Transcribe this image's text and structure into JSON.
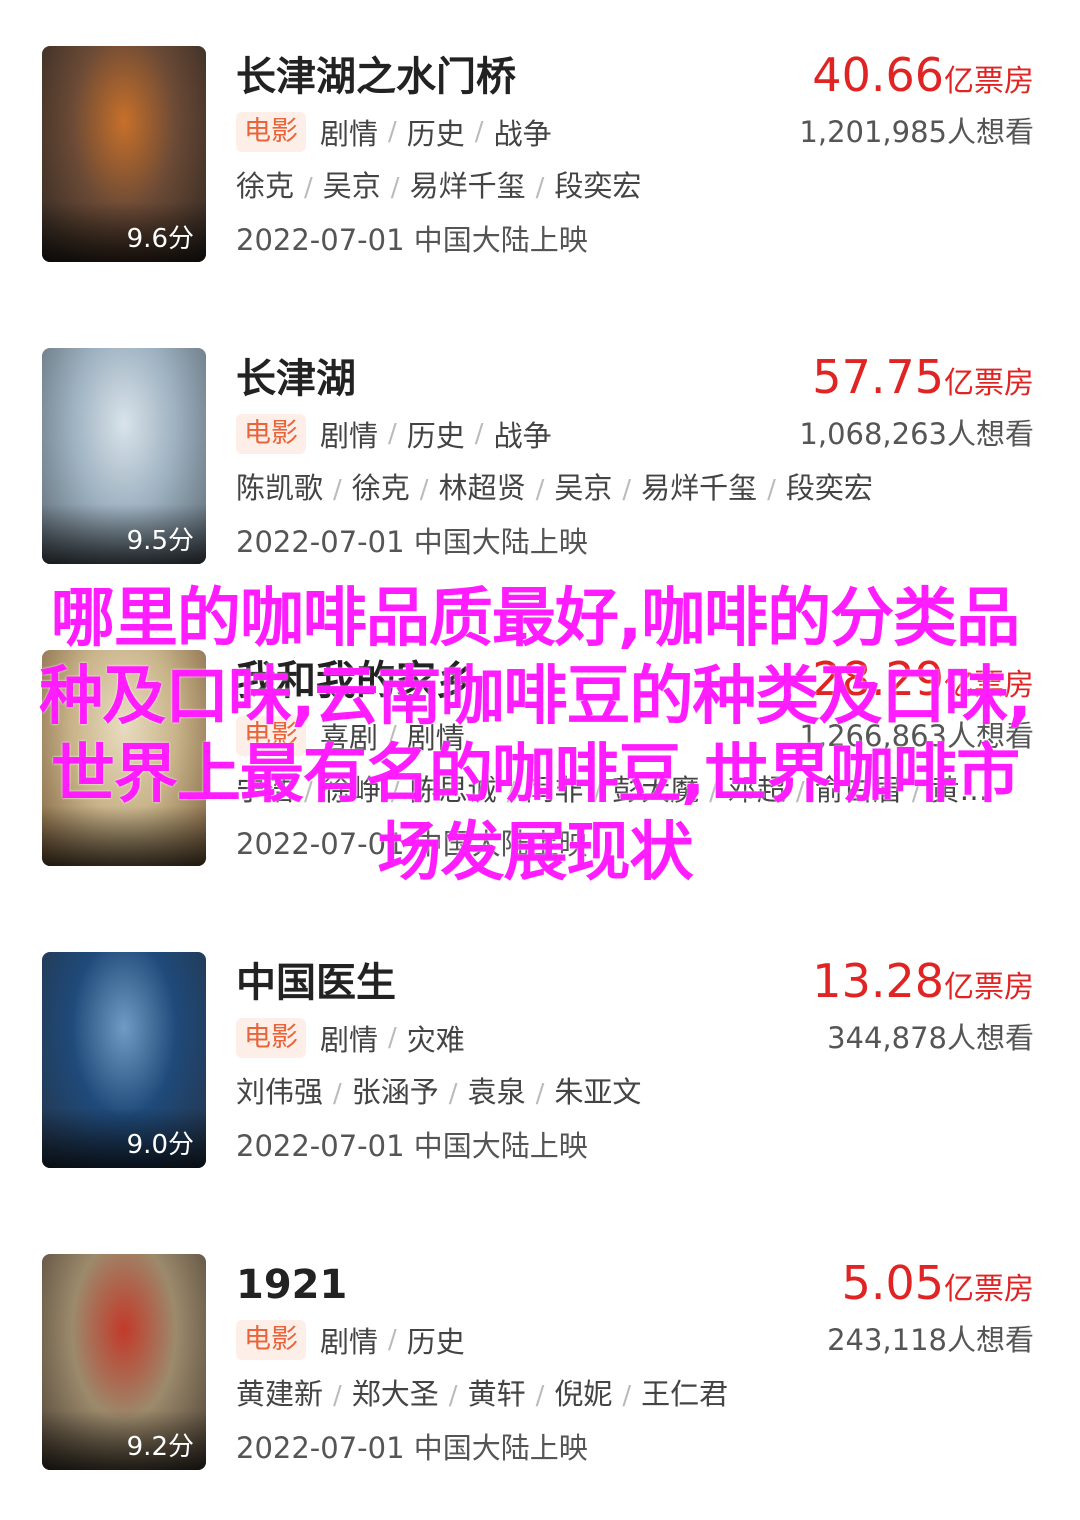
{
  "movies": [
    {
      "title": "长津湖之水门桥",
      "box_num": "40.66",
      "box_unit": "亿票房",
      "type_tag": "电影",
      "genres": [
        "剧情",
        "历史",
        "战争"
      ],
      "want": "1,201,985人想看",
      "cast": [
        "徐克",
        "吴京",
        "易烊千玺",
        "段奕宏"
      ],
      "release": "2022-07-01 中国大陆上映",
      "score": "9.6分",
      "poster_colors": [
        "#6b4a36",
        "#c7702a",
        "#2c2620"
      ]
    },
    {
      "title": "长津湖",
      "box_num": "57.75",
      "box_unit": "亿票房",
      "type_tag": "电影",
      "genres": [
        "剧情",
        "历史",
        "战争"
      ],
      "want": "1,068,263人想看",
      "cast": [
        "陈凯歌",
        "徐克",
        "林超贤",
        "吴京",
        "易烊千玺",
        "段奕宏"
      ],
      "release": "2022-07-01 中国大陆上映",
      "score": "9.5分",
      "poster_colors": [
        "#9db1c0",
        "#d9e3ea",
        "#5a6670"
      ]
    },
    {
      "title": "我和我的家乡",
      "box_num": "28.29",
      "box_unit": "亿票房",
      "type_tag": "电影",
      "genres": [
        "喜剧",
        "剧情"
      ],
      "want": "1,266,863人想看",
      "cast": [
        "宁浩",
        "徐峥",
        "陈思诚",
        "闫非",
        "彭大魔",
        "邓超",
        "俞白眉",
        "黄…"
      ],
      "release": "2022-07-01 中国大陆上映",
      "score": "",
      "poster_colors": [
        "#c9b48a",
        "#e8dcc0",
        "#7a5d3c"
      ]
    },
    {
      "title": "中国医生",
      "box_num": "13.28",
      "box_unit": "亿票房",
      "type_tag": "电影",
      "genres": [
        "剧情",
        "灾难"
      ],
      "want": "344,878人想看",
      "cast": [
        "刘伟强",
        "张涵予",
        "袁泉",
        "朱亚文"
      ],
      "release": "2022-07-01 中国大陆上映",
      "score": "9.0分",
      "poster_colors": [
        "#1f4a7a",
        "#6f9cc4",
        "#243448"
      ]
    },
    {
      "title": "1921",
      "box_num": "5.05",
      "box_unit": "亿票房",
      "type_tag": "电影",
      "genres": [
        "剧情",
        "历史"
      ],
      "want": "243,118人想看",
      "cast": [
        "黄建新",
        "郑大圣",
        "黄轩",
        "倪妮",
        "王仁君"
      ],
      "release": "2022-07-01 中国大陆上映",
      "score": "9.2分",
      "poster_colors": [
        "#9c8a6c",
        "#c23a2a",
        "#4a3f33"
      ]
    }
  ],
  "overlay_text": "哪里的咖啡品质最好,咖啡的分类品种及口味,云南咖啡豆的种类及口味,世界上最有名的咖啡豆,世界咖啡市场发展现状",
  "colors": {
    "box_office": "#e02424",
    "tag_bg": "#fdeee8",
    "tag_fg": "#e8653b",
    "overlay": "#ff1cff"
  }
}
